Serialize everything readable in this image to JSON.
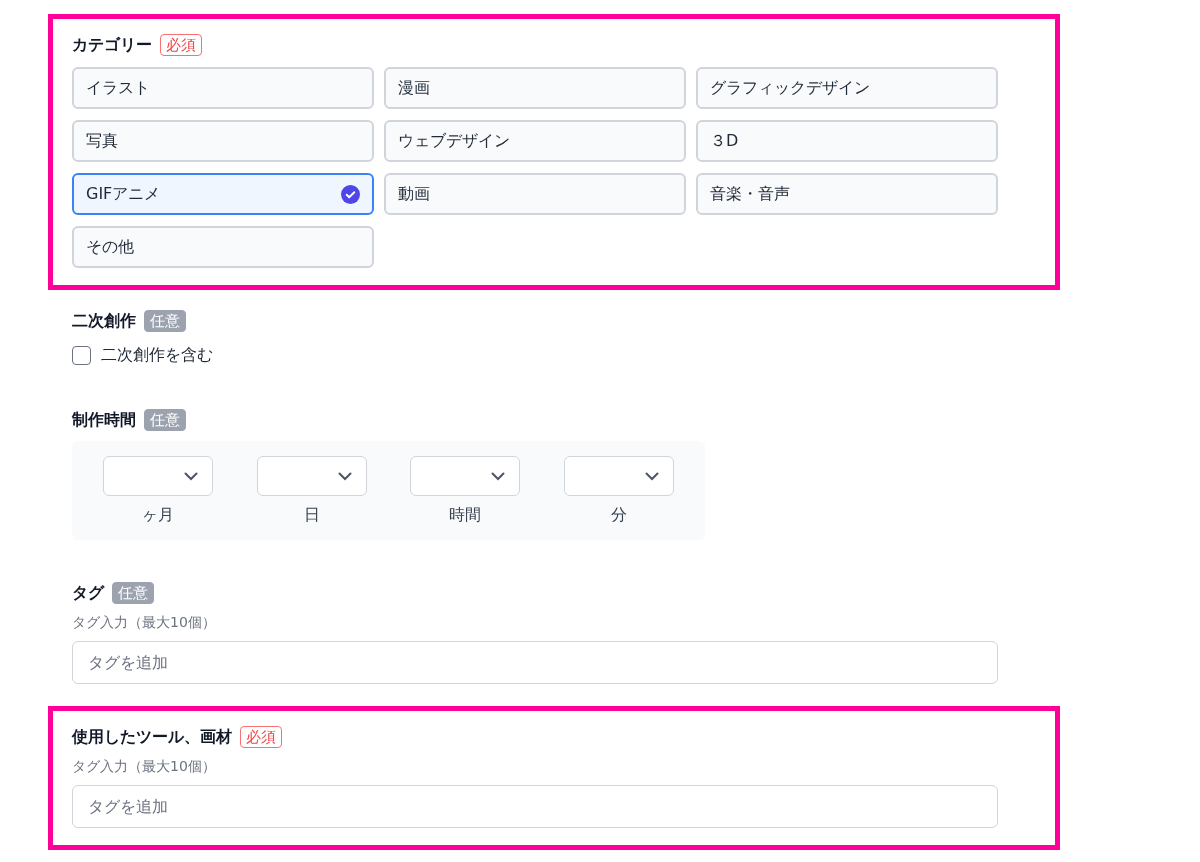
{
  "sections": [
    {
      "kind": "choice_grid",
      "title": "カテゴリー",
      "badge": {
        "text": "必須",
        "kind": "required"
      },
      "highlighted": true,
      "options": [
        {
          "label": "イラスト",
          "selected": false
        },
        {
          "label": "漫画",
          "selected": false
        },
        {
          "label": "グラフィックデザイン",
          "selected": false
        },
        {
          "label": "写真",
          "selected": false
        },
        {
          "label": "ウェブデザイン",
          "selected": false
        },
        {
          "label": "３D",
          "selected": false
        },
        {
          "label": "GIFアニメ",
          "selected": true
        },
        {
          "label": "動画",
          "selected": false
        },
        {
          "label": "音楽・音声",
          "selected": false
        },
        {
          "label": "その他",
          "selected": false
        }
      ]
    },
    {
      "kind": "checkbox",
      "title": "二次創作",
      "badge": {
        "text": "任意",
        "kind": "optional"
      },
      "highlighted": false,
      "checkbox": {
        "label": "二次創作を含む",
        "checked": false
      }
    },
    {
      "kind": "duration",
      "title": "制作時間",
      "badge": {
        "text": "任意",
        "kind": "optional"
      },
      "highlighted": false,
      "units": [
        {
          "label": "ヶ月"
        },
        {
          "label": "日"
        },
        {
          "label": "時間"
        },
        {
          "label": "分"
        }
      ]
    },
    {
      "kind": "tag_input",
      "title": "タグ",
      "badge": {
        "text": "任意",
        "kind": "optional"
      },
      "highlighted": false,
      "hint": "タグ入力（最大10個）",
      "placeholder": "タグを追加"
    },
    {
      "kind": "tag_input",
      "title": "使用したツール、画材",
      "badge": {
        "text": "必須",
        "kind": "required"
      },
      "highlighted": true,
      "hint": "タグ入力（最大10個）",
      "placeholder": "タグを追加"
    }
  ]
}
